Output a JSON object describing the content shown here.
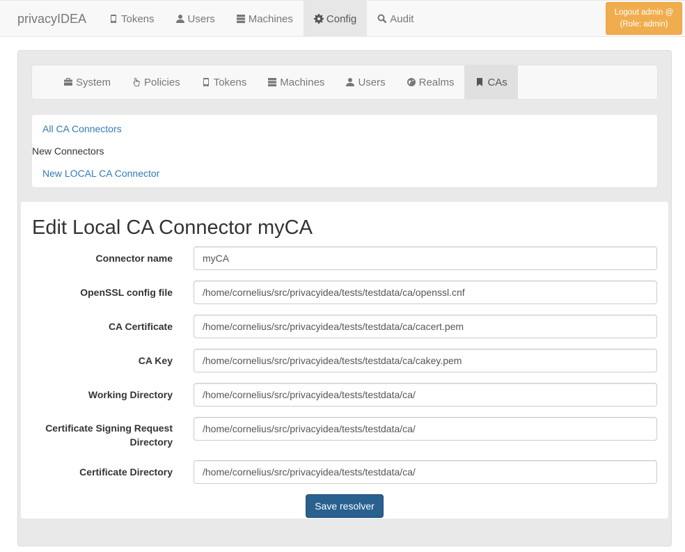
{
  "app": {
    "brand": "privacyIDEA",
    "logout": {
      "line1": "Logout admin @",
      "line2": "(Role: admin)"
    }
  },
  "topnav": {
    "items": [
      {
        "label": "Tokens",
        "icon": "phone-icon"
      },
      {
        "label": "Users",
        "icon": "user-icon"
      },
      {
        "label": "Machines",
        "icon": "server-icon"
      },
      {
        "label": "Config",
        "icon": "gear-icon",
        "active": true
      },
      {
        "label": "Audit",
        "icon": "search-icon"
      }
    ]
  },
  "subnav": {
    "items": [
      {
        "label": "System",
        "icon": "briefcase-icon"
      },
      {
        "label": "Policies",
        "icon": "hand-pointer-icon"
      },
      {
        "label": "Tokens",
        "icon": "phone-icon"
      },
      {
        "label": "Machines",
        "icon": "server-icon"
      },
      {
        "label": "Users",
        "icon": "user-icon"
      },
      {
        "label": "Realms",
        "icon": "globe-icon"
      },
      {
        "label": "CAs",
        "icon": "bookmark-icon",
        "active": true
      }
    ]
  },
  "connectors": {
    "all_link": "All CA Connectors",
    "new_heading": "New Connectors",
    "new_local_link": "New LOCAL CA Connector"
  },
  "form": {
    "title": "Edit Local CA Connector myCA",
    "fields": [
      {
        "label": "Connector name",
        "value": "myCA"
      },
      {
        "label": "OpenSSL config file",
        "value": "/home/cornelius/src/privacyidea/tests/testdata/ca/openssl.cnf"
      },
      {
        "label": "CA Certificate",
        "value": "/home/cornelius/src/privacyidea/tests/testdata/ca/cacert.pem"
      },
      {
        "label": "CA Key",
        "value": "/home/cornelius/src/privacyidea/tests/testdata/ca/cakey.pem"
      },
      {
        "label": "Working Directory",
        "value": "/home/cornelius/src/privacyidea/tests/testdata/ca/"
      },
      {
        "label": "Certificate Signing Request Directory",
        "value": "/home/cornelius/src/privacyidea/tests/testdata/ca/"
      },
      {
        "label": "Certificate Directory",
        "value": "/home/cornelius/src/privacyidea/tests/testdata/ca/"
      }
    ],
    "save_label": "Save resolver"
  },
  "colors": {
    "link": "#337ab7",
    "primary": "#286090",
    "warning": "#f0ad4e",
    "navbar": "#f8f8f8",
    "well": "#e9e9e9"
  }
}
